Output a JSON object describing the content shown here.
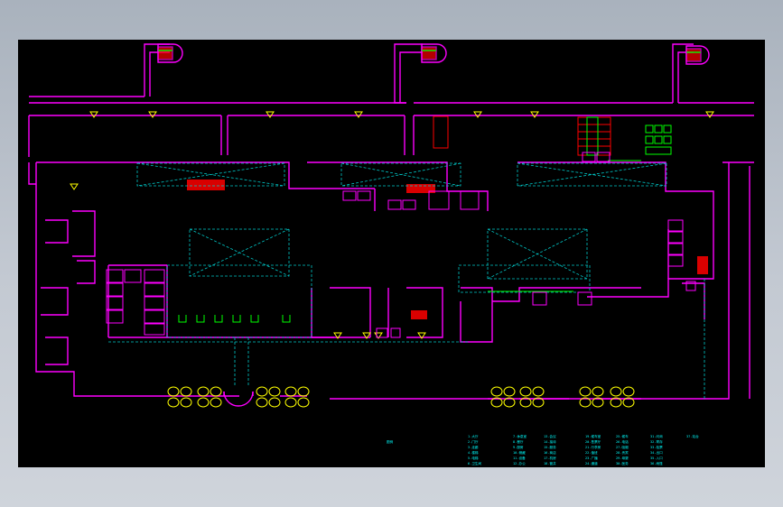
{
  "canvas": {
    "background": "#000000"
  },
  "colors": {
    "wall": "#ff00ff",
    "dashed": "#00c8c8",
    "door": "#ffff00",
    "stair": "#ff0000",
    "fixture": "#00ff00",
    "label": "#00ffff"
  },
  "stair_icons": [
    "stair-symbol",
    "stair-symbol",
    "stair-symbol"
  ],
  "legend": {
    "title": "图例",
    "columns": [
      [
        "1.大厅",
        "2.门厅",
        "3.走廊",
        "4.楼梯",
        "5.电梯",
        "6.卫生间"
      ],
      [
        "7.休息室",
        "8.餐厅",
        "9.厨房",
        "10.储藏",
        "11.设备",
        "12.办公"
      ],
      [
        "13.会议",
        "14.接待",
        "15.服务",
        "16.商店",
        "17.机房",
        "18.管井"
      ],
      [
        "19.候车室",
        "20.售票厅",
        "21.行李房",
        "22.值班",
        "23.广播",
        "24.通道"
      ],
      [
        "25.候车",
        "26.电话",
        "27.吸烟",
        "28.贵宾",
        "29.母婴",
        "30.医务"
      ],
      [
        "31.问询",
        "32.寄存",
        "33.检票",
        "34.出口",
        "35.入口",
        "36.雨篷"
      ],
      [
        "37.站台"
      ]
    ]
  }
}
